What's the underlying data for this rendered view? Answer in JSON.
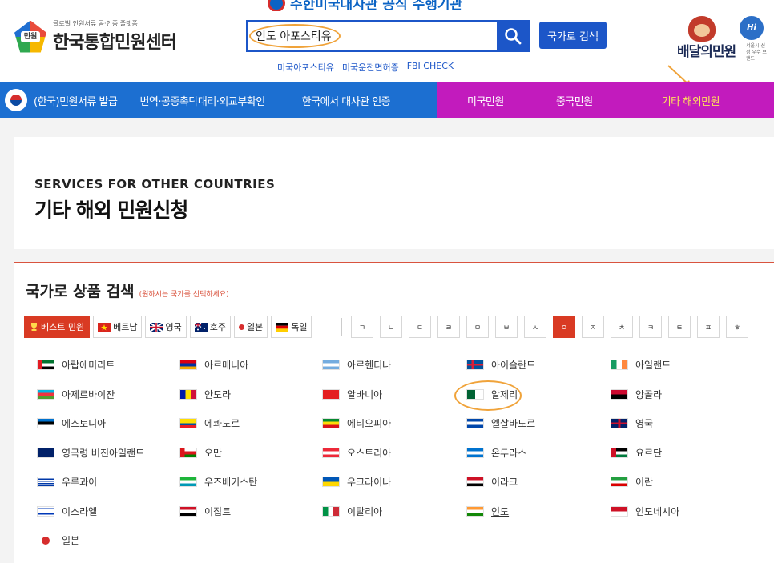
{
  "banner": {
    "text": "주한미국대사관 공식 수행기관"
  },
  "header": {
    "logo_badge": "민원",
    "logo_sub": "글로벌 인원서류 공·인증 플랫폼",
    "logo_main": "한국통합민원센터",
    "search_value": "인도 아포스티유",
    "country_search_label": "국가로 검색",
    "quick_links": [
      "미국아포스티유",
      "미국운전면허증",
      "FBI CHECK"
    ],
    "delivery_text": "배달의민원",
    "delivery_sub": "서울시 선정 우수 브랜드",
    "hi_seoul": "Hi Seoul"
  },
  "nav": {
    "items": [
      "(한국)민원서류 발급",
      "번역·공증촉탁대리·외교부확인",
      "한국에서 대사관 인증",
      "미국민원",
      "중국민원",
      "기타 해외민원"
    ],
    "active_index": 5
  },
  "page": {
    "title_eng": "SERVICES FOR OTHER COUNTRIES",
    "title_kor": "기타 해외 민원신청"
  },
  "list": {
    "title": "국가로 상품 검색",
    "hint": "(원하시는 국가를 선택하세요)",
    "filters": [
      "베스트 민원",
      "베트남",
      "영국",
      "호주",
      "일본",
      "독일"
    ],
    "consonants": [
      "ㄱ",
      "ㄴ",
      "ㄷ",
      "ㄹ",
      "ㅁ",
      "ㅂ",
      "ㅅ",
      "ㅇ",
      "ㅈ",
      "ㅊ",
      "ㅋ",
      "ㅌ",
      "ㅍ",
      "ㅎ"
    ],
    "active_consonant": "ㅇ",
    "countries": [
      "아랍에미리트",
      "아르메니아",
      "아르헨티나",
      "아이슬란드",
      "아일랜드",
      "아제르바이잔",
      "안도라",
      "알바니아",
      "알제리",
      "앙골라",
      "에스토니아",
      "에콰도르",
      "에티오피아",
      "엘살바도르",
      "영국",
      "영국령 버진아일랜드",
      "오만",
      "오스트리아",
      "온두라스",
      "요르단",
      "우루과이",
      "우즈베키스탄",
      "우크라이나",
      "이라크",
      "이란",
      "이스라엘",
      "이집트",
      "이탈리아",
      "인도",
      "인도네시아",
      "일본"
    ],
    "highlighted_country": "인도"
  },
  "colors": {
    "nav_blue": "#1c6fd1",
    "nav_magenta": "#c21bbd",
    "accent_red": "#d93a23",
    "brand_blue": "#1c56c8",
    "highlight_orange": "#f0a33a"
  }
}
